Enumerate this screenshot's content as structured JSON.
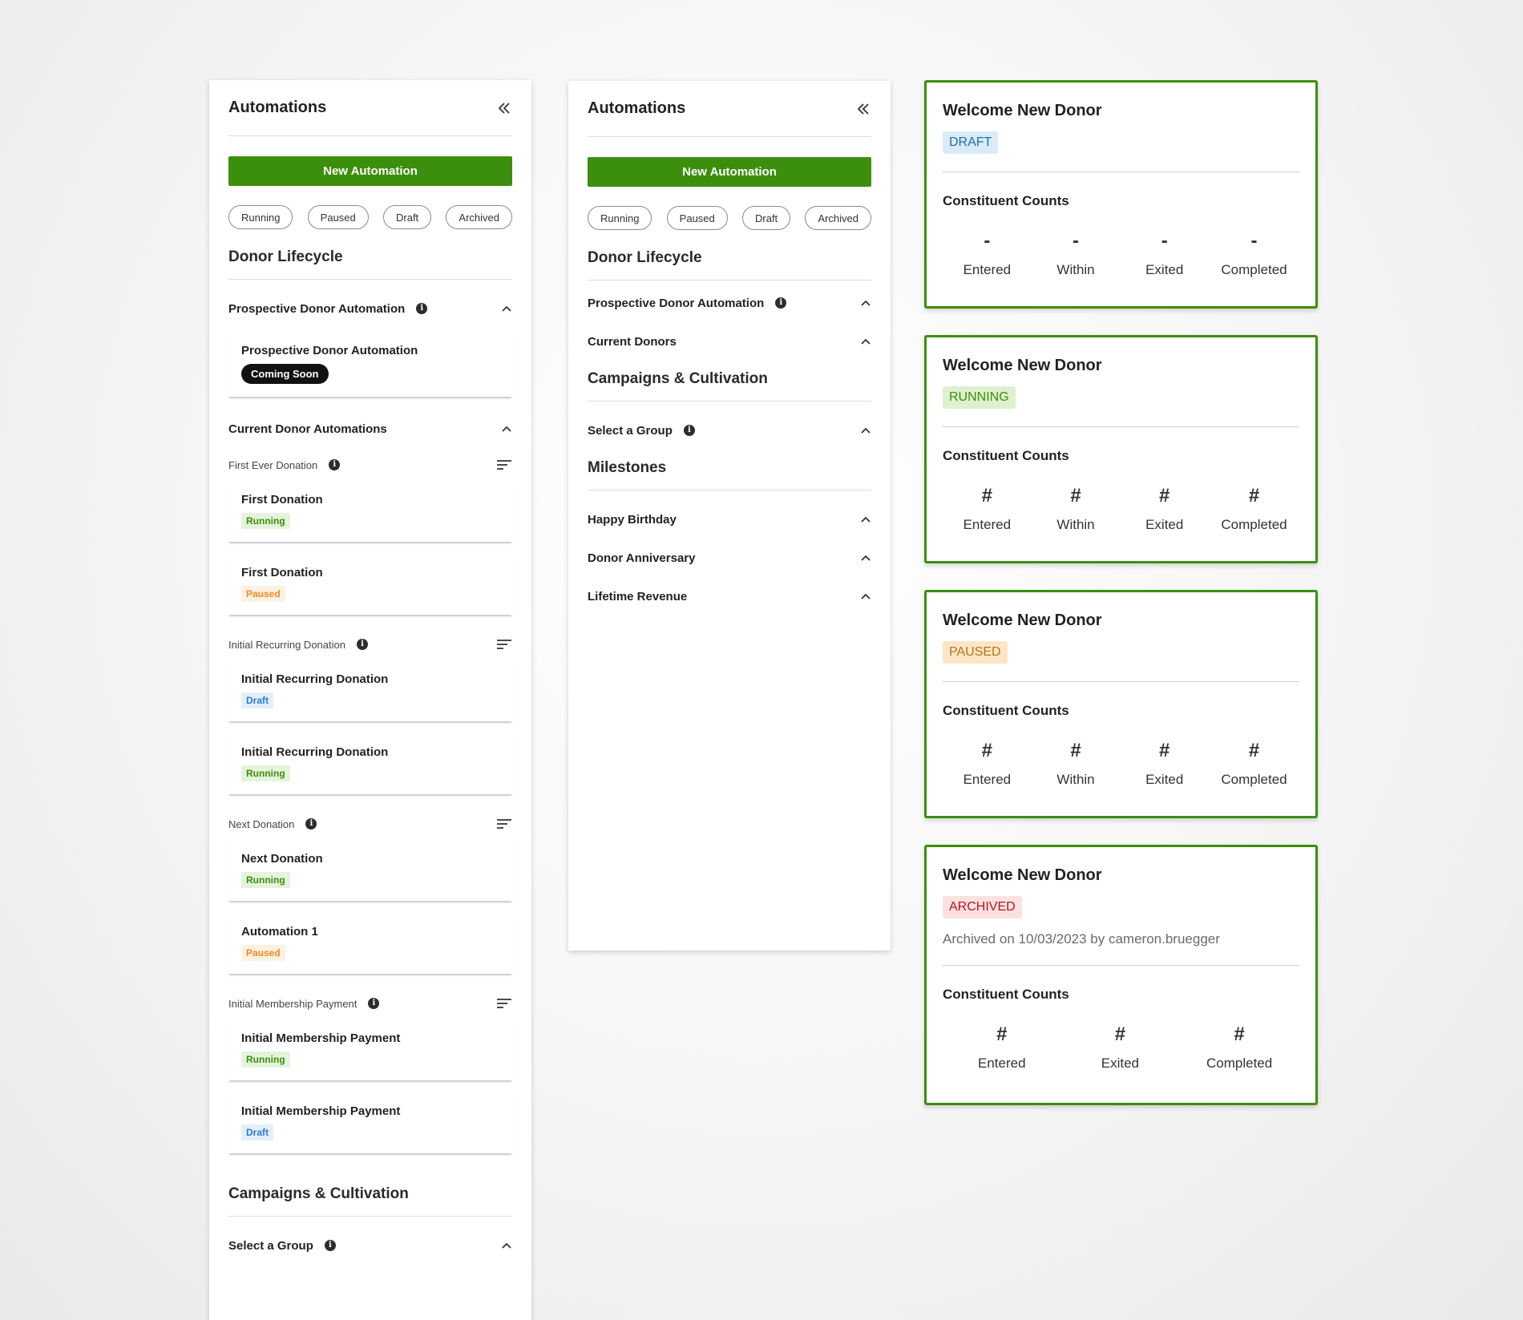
{
  "panel_a": {
    "title": "Automations",
    "new_button": "New Automation",
    "filters": [
      "Running",
      "Paused",
      "Draft",
      "Archived"
    ],
    "section_donor": "Donor Lifecycle",
    "group_prospective": "Prospective Donor Automation",
    "prospective_card": {
      "title": "Prospective Donor Automation",
      "badge": "Coming Soon"
    },
    "group_current": "Current Donor Automations",
    "subgroups": [
      {
        "label": "First Ever Donation",
        "cards": [
          {
            "title": "First Donation",
            "badge": "Running"
          },
          {
            "title": "First Donation",
            "badge": "Paused"
          }
        ]
      },
      {
        "label": "Initial Recurring Donation",
        "cards": [
          {
            "title": "Initial Recurring Donation",
            "badge": "Draft"
          },
          {
            "title": "Initial Recurring Donation",
            "badge": "Running"
          }
        ]
      },
      {
        "label": "Next Donation",
        "cards": [
          {
            "title": "Next Donation",
            "badge": "Running"
          },
          {
            "title": "Automation 1",
            "badge": "Paused"
          }
        ]
      },
      {
        "label": "Initial Membership Payment",
        "cards": [
          {
            "title": "Initial Membership Payment",
            "badge": "Running"
          },
          {
            "title": "Initial Membership Payment",
            "badge": "Draft"
          }
        ]
      }
    ],
    "section_campaigns": "Campaigns & Cultivation",
    "group_select": "Select a Group"
  },
  "panel_b": {
    "title": "Automations",
    "new_button": "New Automation",
    "filters": [
      "Running",
      "Paused",
      "Draft",
      "Archived"
    ],
    "section_donor": "Donor Lifecycle",
    "group_prospective": "Prospective Donor Automation",
    "group_current": "Current Donors",
    "section_campaigns": "Campaigns & Cultivation",
    "group_select": "Select a Group",
    "section_milestones": "Milestones",
    "milestones": [
      "Happy Birthday",
      "Donor Anniversary",
      "Lifetime Revenue"
    ]
  },
  "details": [
    {
      "title": "Welcome New Donor",
      "status": "DRAFT",
      "counts_title": "Constituent Counts",
      "counts": [
        {
          "value": "-",
          "label": "Entered"
        },
        {
          "value": "-",
          "label": "Within"
        },
        {
          "value": "-",
          "label": "Exited"
        },
        {
          "value": "-",
          "label": "Completed"
        }
      ]
    },
    {
      "title": "Welcome New Donor",
      "status": "RUNNING",
      "counts_title": "Constituent Counts",
      "counts": [
        {
          "value": "#",
          "label": "Entered"
        },
        {
          "value": "#",
          "label": "Within"
        },
        {
          "value": "#",
          "label": "Exited"
        },
        {
          "value": "#",
          "label": "Completed"
        }
      ]
    },
    {
      "title": "Welcome New Donor",
      "status": "PAUSED",
      "counts_title": "Constituent Counts",
      "counts": [
        {
          "value": "#",
          "label": "Entered"
        },
        {
          "value": "#",
          "label": "Within"
        },
        {
          "value": "#",
          "label": "Exited"
        },
        {
          "value": "#",
          "label": "Completed"
        }
      ]
    },
    {
      "title": "Welcome New Donor",
      "status": "ARCHIVED",
      "note": "Archived on 10/03/2023 by cameron.bruegger",
      "counts_title": "Constituent Counts",
      "counts": [
        {
          "value": "#",
          "label": "Entered"
        },
        {
          "value": "#",
          "label": "Exited"
        },
        {
          "value": "#",
          "label": "Completed"
        }
      ]
    }
  ],
  "icons": {
    "collapse": "double-chevron-left-icon",
    "chevron": "chevron-up-icon",
    "info": "info-icon",
    "sort": "sort-icon"
  },
  "colors": {
    "primary_green": "#3b8f0c",
    "running": "#3b8f0c",
    "paused": "#f08a24",
    "draft": "#2d7bd1",
    "archived": "#b3161f"
  }
}
